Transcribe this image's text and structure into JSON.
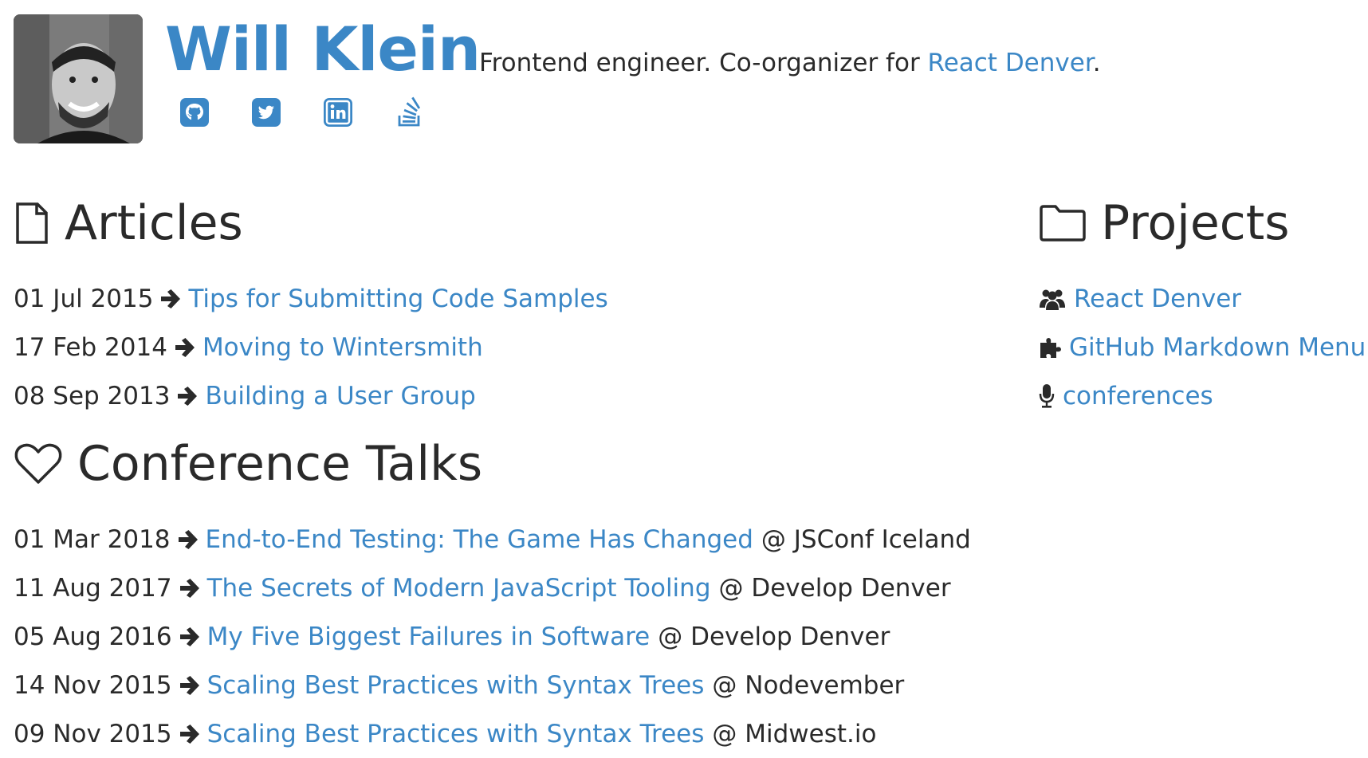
{
  "profile": {
    "name": "Will Klein",
    "tagline_prefix": "Frontend engineer. Co-organizer for ",
    "tagline_link": "React Denver",
    "tagline_suffix": ".",
    "avatar_alt": "Will Klein"
  },
  "social": [
    {
      "icon": "github-icon"
    },
    {
      "icon": "twitter-icon"
    },
    {
      "icon": "linkedin-icon"
    },
    {
      "icon": "stackoverflow-icon"
    }
  ],
  "articles": {
    "title": "Articles",
    "items": [
      {
        "date": "01 Jul 2015",
        "title": "Tips for Submitting Code Samples"
      },
      {
        "date": "17 Feb 2014",
        "title": "Moving to Wintersmith"
      },
      {
        "date": "08 Sep 2013",
        "title": "Building a User Group"
      }
    ]
  },
  "talks": {
    "title": "Conference Talks",
    "items": [
      {
        "date": "01 Mar 2018",
        "title": "End-to-End Testing: The Game Has Changed",
        "venue": "@ JSConf Iceland"
      },
      {
        "date": "11 Aug 2017",
        "title": "The Secrets of Modern JavaScript Tooling",
        "venue": "@ Develop Denver"
      },
      {
        "date": "05 Aug 2016",
        "title": "My Five Biggest Failures in Software",
        "venue": "@ Develop Denver"
      },
      {
        "date": "14 Nov 2015",
        "title": "Scaling Best Practices with Syntax Trees",
        "venue": "@ Nodevember"
      },
      {
        "date": "09 Nov 2015",
        "title": "Scaling Best Practices with Syntax Trees",
        "venue": "@ Midwest.io"
      }
    ]
  },
  "projects": {
    "title": "Projects",
    "items": [
      {
        "icon": "users-icon",
        "label": "React Denver"
      },
      {
        "icon": "puzzle-icon",
        "label": "GitHub Markdown Menu"
      },
      {
        "icon": "microphone-icon",
        "label": "conferences"
      }
    ]
  },
  "colors": {
    "link": "#3b87c6",
    "text": "#2a2a2a"
  }
}
